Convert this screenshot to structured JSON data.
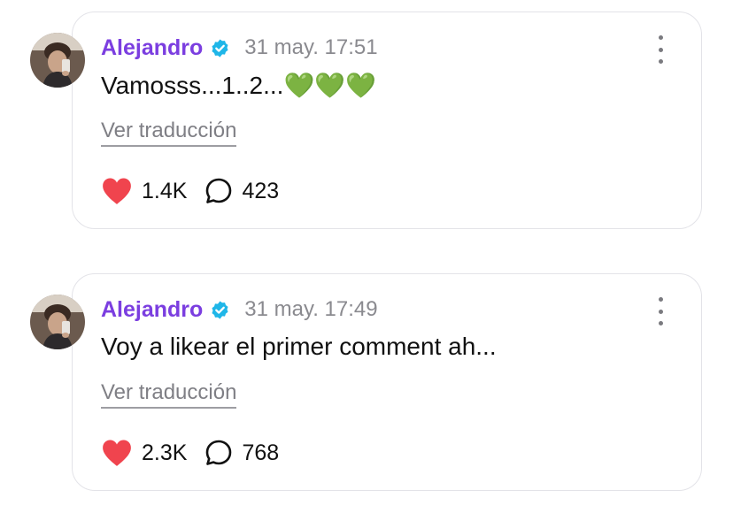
{
  "posts": [
    {
      "author": "Alejandro",
      "timestamp": "31 may. 17:51",
      "text": "Vamosss...1..2...💚💚💚",
      "translate_label": "Ver traducción",
      "likes": "1.4K",
      "comments": "423"
    },
    {
      "author": "Alejandro",
      "timestamp": "31 may. 17:49",
      "text": "Voy a likear el primer comment ah...",
      "translate_label": "Ver traducción",
      "likes": "2.3K",
      "comments": "768"
    }
  ],
  "colors": {
    "author": "#7b3ee0",
    "verified": "#1fb6e8",
    "heart": "#f0444e",
    "muted": "#8a8a8f",
    "card_border": "#e3e3e8"
  },
  "icons": {
    "verified": "verified-badge-icon",
    "more": "more-options-icon",
    "like": "heart-icon",
    "comment": "comment-bubble-icon"
  }
}
